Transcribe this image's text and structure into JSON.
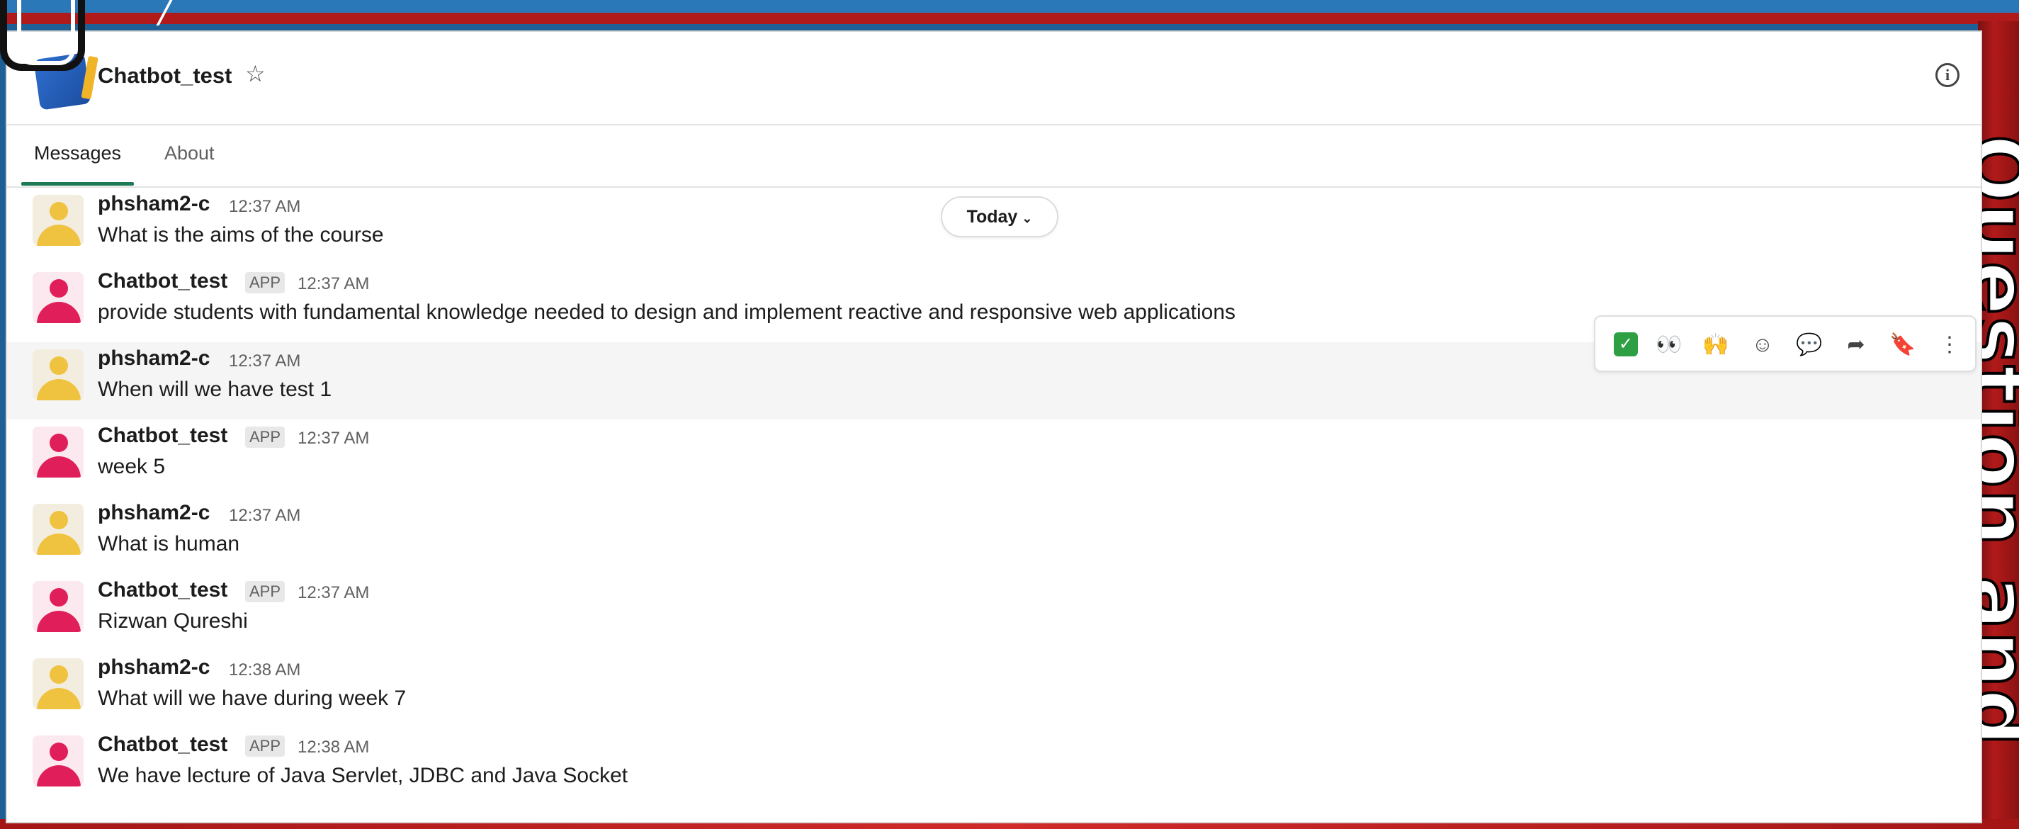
{
  "backdrop": {
    "vertical_title": "Question and"
  },
  "header": {
    "channel_name": "Chatbot_test",
    "star_icon": "star-outline-icon",
    "info_icon": "info-icon"
  },
  "tabs": [
    {
      "label": "Messages",
      "active": true
    },
    {
      "label": "About",
      "active": false
    }
  ],
  "date_divider": {
    "label": "Today",
    "icon": "chevron-down-icon"
  },
  "messages": [
    {
      "author": "phsham2-c",
      "app": false,
      "time": "12:37 AM",
      "text": "What is the aims of the course"
    },
    {
      "author": "Chatbot_test",
      "app": true,
      "badge": "APP",
      "time": "12:37 AM",
      "text": "provide students with fundamental knowledge needed to design and implement reactive and responsive web applications"
    },
    {
      "author": "phsham2-c",
      "app": false,
      "time": "12:37 AM",
      "text": "When will we have test 1"
    },
    {
      "author": "Chatbot_test",
      "app": true,
      "badge": "APP",
      "time": "12:37 AM",
      "text": "week 5"
    },
    {
      "author": "phsham2-c",
      "app": false,
      "time": "12:37 AM",
      "text": "What is human"
    },
    {
      "author": "Chatbot_test",
      "app": true,
      "badge": "APP",
      "time": "12:37 AM",
      "text": "Rizwan Qureshi"
    },
    {
      "author": "phsham2-c",
      "app": false,
      "time": "12:38 AM",
      "text": "What will we have during week 7"
    },
    {
      "author": "Chatbot_test",
      "app": true,
      "badge": "APP",
      "time": "12:38 AM",
      "text": "We have lecture of Java Servlet, JDBC and Java Socket"
    }
  ],
  "message_actions": [
    {
      "name": "checkmark-reaction",
      "glyph": "✓"
    },
    {
      "name": "eyes-reaction",
      "glyph": "👀"
    },
    {
      "name": "raised-hands-reaction",
      "glyph": "🙌"
    },
    {
      "name": "add-reaction",
      "glyph": "☺"
    },
    {
      "name": "reply-in-thread",
      "glyph": "💬"
    },
    {
      "name": "forward-message",
      "glyph": "➦"
    },
    {
      "name": "save-for-later",
      "glyph": "🔖"
    },
    {
      "name": "more-actions",
      "glyph": "⋮"
    }
  ],
  "colors": {
    "accent_tab": "#1d7a55",
    "user_avatar": "#efc23f",
    "bot_avatar": "#e01e5a"
  }
}
